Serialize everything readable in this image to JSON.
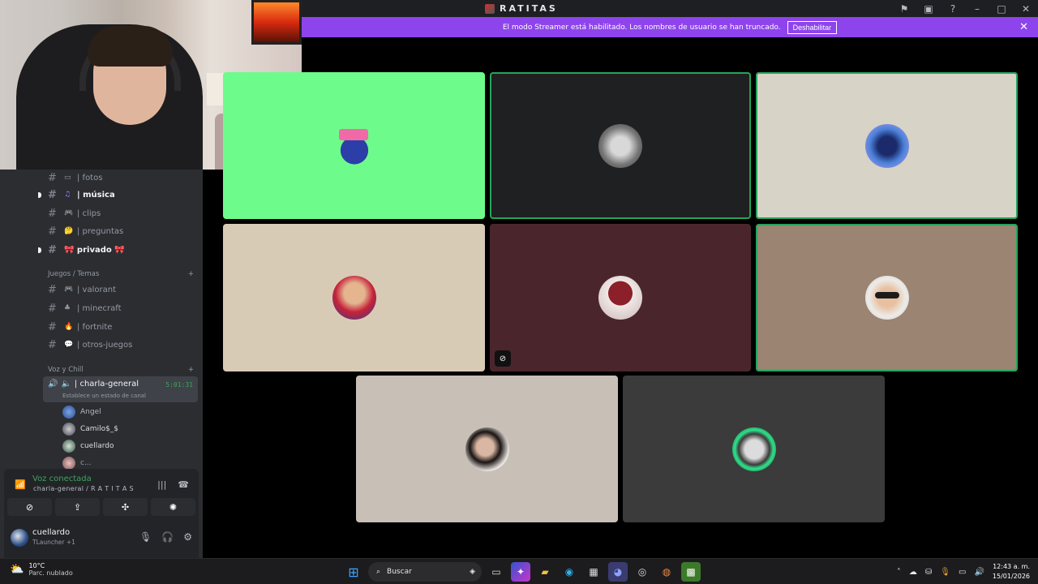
{
  "app": {
    "title": "RATITAS"
  },
  "banner": {
    "text": "El modo Streamer está habilitado. Los nombres de usuario se han truncado.",
    "button": "Deshabilitar"
  },
  "sidebar": {
    "channels_top": [
      {
        "emoji": "▭",
        "label": "| fotos",
        "bold": false
      },
      {
        "emoji": "♫",
        "label": "| música",
        "bold": true
      },
      {
        "emoji": "🎮",
        "label": "| clips",
        "bold": false
      },
      {
        "emoji": "🤔",
        "label": "| preguntas",
        "bold": false
      },
      {
        "emoji": "",
        "label": "🎀 privado 🎀",
        "bold": true
      }
    ],
    "category_games": "Juegos / Temas",
    "channels_games": [
      {
        "emoji": "🎮",
        "label": "| valorant"
      },
      {
        "emoji": "♣",
        "label": "| minecraft"
      },
      {
        "emoji": "🔥",
        "label": "| fortnite"
      },
      {
        "emoji": "💬",
        "label": "| otros-juegos"
      }
    ],
    "category_voice": "Voz y Chill",
    "voice_channel": {
      "label": "| charla-general",
      "time": "5:01:31",
      "status": "Establece un estado de canal"
    },
    "members": [
      "Angel",
      "Camilo$_$",
      "cuellardo",
      "c..."
    ]
  },
  "voice_panel": {
    "status": "Voz conectada",
    "subtitle": "charla-general / R A T I T A S"
  },
  "user_panel": {
    "name": "cuellardo",
    "status": "TLauncher +1"
  },
  "tiles": [
    {
      "bg": "#6dfc8b",
      "speaking": false,
      "avatar": "blue-bird-pink-hat"
    },
    {
      "bg": "#1f2021",
      "speaking": true,
      "avatar": "gray-photo"
    },
    {
      "bg": "#d7d3c7",
      "speaking": true,
      "avatar": "blue-anime"
    },
    {
      "bg": "#d8cbb6",
      "speaking": false,
      "avatar": "boy-selfie"
    },
    {
      "bg": "#4a262c",
      "speaking": false,
      "avatar": "red-cap-character"
    },
    {
      "bg": "#9b8472",
      "speaking": true,
      "avatar": "man-sunglasses"
    },
    {
      "bg": "#c8bfb6",
      "speaking": false,
      "avatar": "girl-mirror"
    },
    {
      "bg": "#3b3b3b",
      "speaking": false,
      "avatar": "green-frame-character"
    }
  ],
  "taskbar": {
    "weather_temp": "10°C",
    "weather_desc": "Parc. nublado",
    "search_placeholder": "Buscar",
    "time": "12:43 a. m.",
    "date": "15/01/2026"
  }
}
